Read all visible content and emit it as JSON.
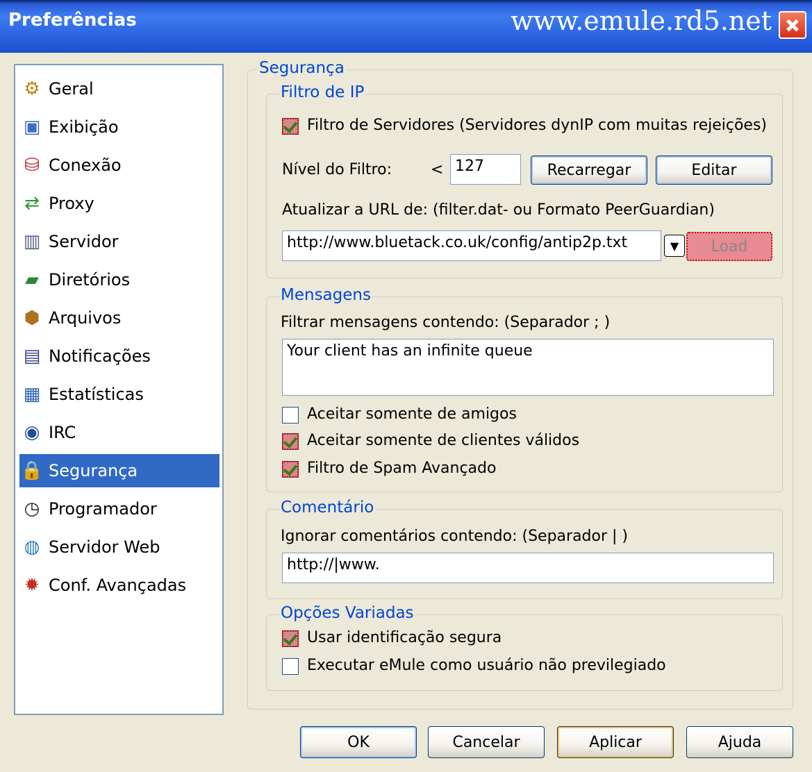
{
  "window": {
    "title": "Preferências",
    "watermark": "www.emule.rd5.net"
  },
  "sidebar": {
    "items": [
      {
        "label": "Geral",
        "icon": "gear-icon",
        "glyph": "⚙",
        "color": "#c08000"
      },
      {
        "label": "Exibição",
        "icon": "monitor-icon",
        "glyph": "▣",
        "color": "#3a70c0"
      },
      {
        "label": "Conexão",
        "icon": "connection-icon",
        "glyph": "⛁",
        "color": "#c02020"
      },
      {
        "label": "Proxy",
        "icon": "proxy-icon",
        "glyph": "⇄",
        "color": "#2a9a2a"
      },
      {
        "label": "Servidor",
        "icon": "server-icon",
        "glyph": "▥",
        "color": "#506080"
      },
      {
        "label": "Diretórios",
        "icon": "folder-icon",
        "glyph": "▰",
        "color": "#2a8a3a"
      },
      {
        "label": "Arquivos",
        "icon": "files-icon",
        "glyph": "⬢",
        "color": "#b07020"
      },
      {
        "label": "Notificações",
        "icon": "notification-icon",
        "glyph": "▤",
        "color": "#304080"
      },
      {
        "label": "Estatísticas",
        "icon": "statistics-icon",
        "glyph": "▦",
        "color": "#2a60b0"
      },
      {
        "label": "IRC",
        "icon": "irc-icon",
        "glyph": "◉",
        "color": "#205090"
      },
      {
        "label": "Segurança",
        "icon": "lock-icon",
        "glyph": "🔒",
        "color": "#e0a020",
        "selected": true
      },
      {
        "label": "Programador",
        "icon": "clock-icon",
        "glyph": "◷",
        "color": "#222222"
      },
      {
        "label": "Servidor Web",
        "icon": "globe-icon",
        "glyph": "◍",
        "color": "#2a80b0"
      },
      {
        "label": "Conf. Avançadas",
        "icon": "advanced-settings-icon",
        "glyph": "✹",
        "color": "#c03020"
      }
    ]
  },
  "panel": {
    "title": "Segurança",
    "ipfilter": {
      "legend": "Filtro de IP",
      "server_filter_label": "Filtro de Servidores (Servidores dynIP com muitas rejeições)",
      "server_filter_checked": true,
      "level_label": "Nível do Filtro:",
      "level_op": "<",
      "level_value": "127",
      "reload_label": "Recarregar",
      "edit_label": "Editar",
      "url_label": "Atualizar a URL de: (filter.dat- ou Formato PeerGuardian)",
      "url_value": "http://www.bluetack.co.uk/config/antip2p.txt",
      "load_label": "Load"
    },
    "messages": {
      "legend": "Mensagens",
      "filter_label": "Filtrar mensagens contendo: (Separador ; )",
      "filter_value": "Your client has an infinite queue",
      "friends_only_label": "Aceitar somente de amigos",
      "friends_only_checked": false,
      "valid_clients_label": "Aceitar somente de clientes válidos",
      "valid_clients_checked": true,
      "spam_filter_label": "Filtro de Spam Avançado",
      "spam_filter_checked": true
    },
    "comments": {
      "legend": "Comentário",
      "ignore_label": "Ignorar comentários contendo: (Separador | )",
      "ignore_value": "http://|www."
    },
    "misc": {
      "legend": "Opções Variadas",
      "secure_id_label": "Usar identificação segura",
      "secure_id_checked": true,
      "unprivileged_label": "Executar eMule como usuário não previlegiado",
      "unprivileged_checked": false
    }
  },
  "footer": {
    "ok_label": "OK",
    "cancel_label": "Cancelar",
    "apply_label": "Aplicar",
    "help_label": "Ajuda"
  }
}
